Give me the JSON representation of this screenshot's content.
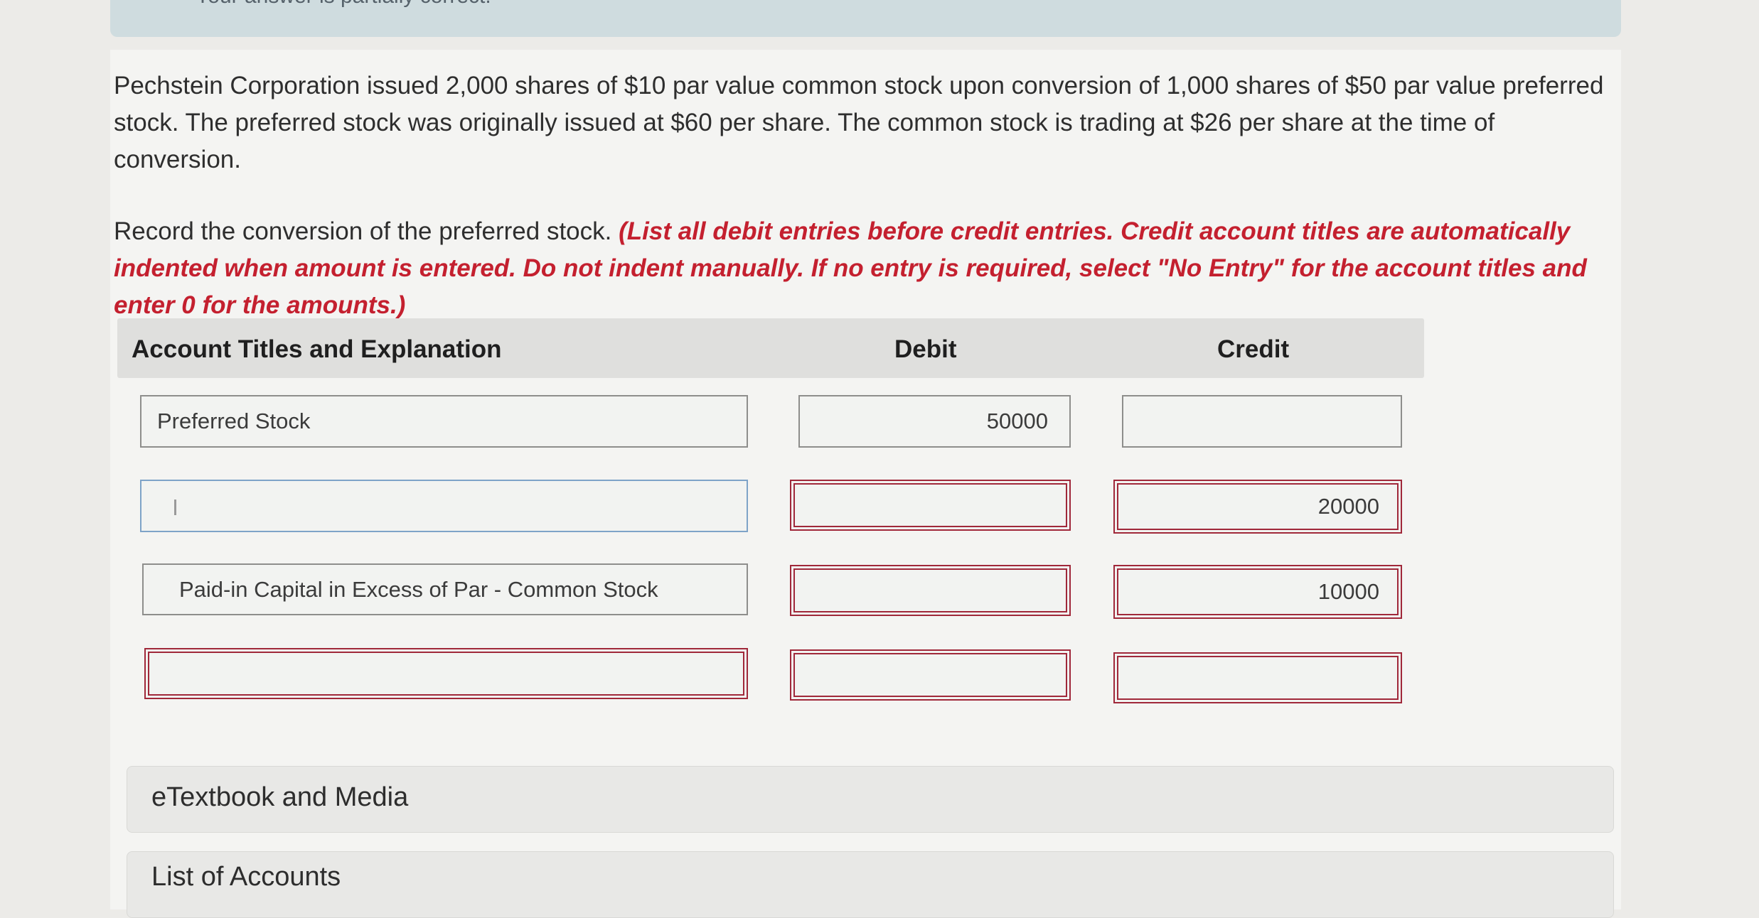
{
  "banner": {
    "text": "Your answer is partially correct."
  },
  "question": {
    "text": "Pechstein Corporation issued 2,000 shares of $10 par value common stock upon conversion of 1,000 shares of $50 par value preferred stock. The preferred stock was originally issued at $60 per share. The common stock is trading at $26 per share at the time of conversion."
  },
  "instruction": {
    "lead": "Record the conversion of the preferred stock.",
    "note": "(List all debit entries before credit entries. Credit account titles are automatically indented when amount is entered. Do not indent manually. If no entry is required, select \"No Entry\" for the account titles and enter 0 for the amounts.)"
  },
  "table": {
    "headers": {
      "account": "Account Titles and Explanation",
      "debit": "Debit",
      "credit": "Credit"
    },
    "rows": [
      {
        "account": "Preferred Stock",
        "debit": "50000",
        "credit": "",
        "status": "ok"
      },
      {
        "account": "",
        "debit": "",
        "credit": "20000",
        "status": "incorrect"
      },
      {
        "account": "Paid-in Capital in Excess of Par - Common Stock",
        "debit": "",
        "credit": "10000",
        "status": "incorrect"
      },
      {
        "account": "",
        "debit": "",
        "credit": "",
        "status": "incorrect"
      }
    ]
  },
  "panels": {
    "etextbook": "eTextbook and Media",
    "accounts": "List of Accounts"
  },
  "colors": {
    "error_border": "#a0283a",
    "instruction_red": "#c4202f",
    "focus_border": "#7ea3c8"
  }
}
